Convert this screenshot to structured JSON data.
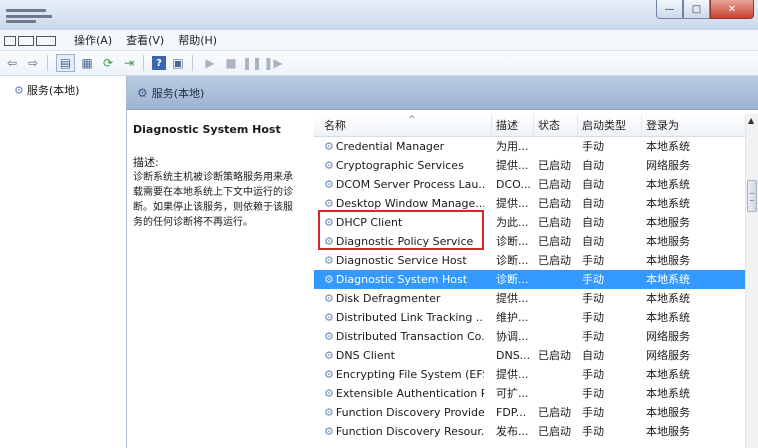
{
  "window": {
    "minimize_glyph": "—",
    "maximize_glyph": "□",
    "close_glyph": "✕"
  },
  "menu": {
    "items": [
      "操作(A)",
      "查看(V)",
      "帮助(H)"
    ]
  },
  "toolbar": {
    "icons": [
      "back-arrow-icon",
      "forward-arrow-icon",
      "console-tree-icon",
      "properties-icon",
      "refresh-icon",
      "export-icon",
      "help-icon",
      "view-icon",
      "play-icon",
      "stop-icon",
      "pause-icon",
      "restart-icon"
    ]
  },
  "tree": {
    "root_label": "服务(本地)"
  },
  "pane": {
    "header_title": "服务(本地)"
  },
  "details": {
    "service_name": "Diagnostic System Host",
    "description_label": "描述:",
    "description_text": "诊断系统主机被诊断策略服务用来承\n载需要在本地系统上下文中运行的诊\n断。如果停止该服务，则依赖于该服\n务的任何诊断将不再运行。"
  },
  "table": {
    "columns": {
      "name": "名称",
      "description": "描述",
      "status": "状态",
      "startup": "启动类型",
      "logon": "登录为"
    },
    "rows": [
      {
        "name": "Credential Manager",
        "description": "为用...",
        "status": "",
        "startup": "手动",
        "logon": "本地系统"
      },
      {
        "name": "Cryptographic Services",
        "description": "提供...",
        "status": "已启动",
        "startup": "自动",
        "logon": "网络服务"
      },
      {
        "name": "DCOM Server Process Lau...",
        "description": "DCO...",
        "status": "已启动",
        "startup": "自动",
        "logon": "本地系统"
      },
      {
        "name": "Desktop Window Manage...",
        "description": "提供...",
        "status": "已启动",
        "startup": "自动",
        "logon": "本地系统"
      },
      {
        "name": "DHCP Client",
        "description": "为此...",
        "status": "已启动",
        "startup": "自动",
        "logon": "本地服务"
      },
      {
        "name": "Diagnostic Policy Service",
        "description": "诊断...",
        "status": "已启动",
        "startup": "自动",
        "logon": "本地服务"
      },
      {
        "name": "Diagnostic Service Host",
        "description": "诊断...",
        "status": "已启动",
        "startup": "手动",
        "logon": "本地服务"
      },
      {
        "name": "Diagnostic System Host",
        "description": "诊断...",
        "status": "",
        "startup": "手动",
        "logon": "本地系统"
      },
      {
        "name": "Disk Defragmenter",
        "description": "提供...",
        "status": "",
        "startup": "手动",
        "logon": "本地系统"
      },
      {
        "name": "Distributed Link Tracking ...",
        "description": "维护...",
        "status": "",
        "startup": "手动",
        "logon": "本地系统"
      },
      {
        "name": "Distributed Transaction Co...",
        "description": "协调...",
        "status": "",
        "startup": "手动",
        "logon": "网络服务"
      },
      {
        "name": "DNS Client",
        "description": "DNS...",
        "status": "已启动",
        "startup": "自动",
        "logon": "网络服务"
      },
      {
        "name": "Encrypting File System (EFS)",
        "description": "提供...",
        "status": "",
        "startup": "手动",
        "logon": "本地系统"
      },
      {
        "name": "Extensible Authentication P...",
        "description": "可扩...",
        "status": "",
        "startup": "手动",
        "logon": "本地系统"
      },
      {
        "name": "Function Discovery Provide...",
        "description": "FDP...",
        "status": "已启动",
        "startup": "手动",
        "logon": "本地服务"
      },
      {
        "name": "Function Discovery Resour...",
        "description": "发布...",
        "status": "已启动",
        "startup": "手动",
        "logon": "本地服务"
      }
    ],
    "selected_row_index": 7,
    "highlighted_rows": [
      6,
      7
    ]
  },
  "colors": {
    "selection": "#3399ff",
    "highlight_border": "#d52a2a",
    "pane_header": "#b8cbe2"
  }
}
